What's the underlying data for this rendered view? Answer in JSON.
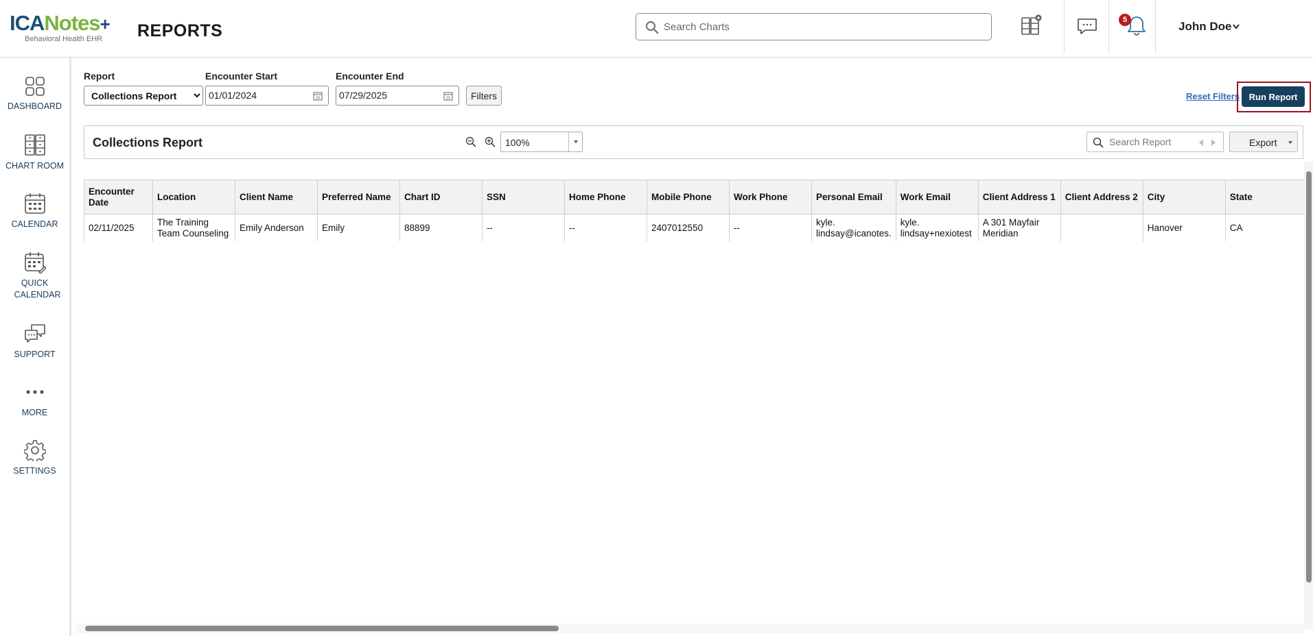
{
  "header": {
    "logo_text_1": "ICA",
    "logo_text_2": "Notes",
    "logo_plus": "+",
    "logo_subtitle": "Behavioral Health EHR",
    "page_title": "REPORTS",
    "search_placeholder": "Search Charts",
    "notification_count": "5",
    "user_name": "John Doe"
  },
  "sidebar": {
    "items": [
      {
        "label": "DASHBOARD"
      },
      {
        "label": "CHART ROOM"
      },
      {
        "label": "CALENDAR"
      },
      {
        "label": "QUICK CALENDAR"
      },
      {
        "label": "SUPPORT"
      },
      {
        "label": "MORE"
      },
      {
        "label": "SETTINGS"
      }
    ]
  },
  "filters": {
    "report_label": "Report",
    "report_value": "Collections Report",
    "encounter_start_label": "Encounter Start",
    "encounter_start_value": "01/01/2024",
    "encounter_end_label": "Encounter End",
    "encounter_end_value": "07/29/2025",
    "filters_button": "Filters",
    "reset_filters": "Reset Filters",
    "run_report": "Run Report"
  },
  "report_panel": {
    "title": "Collections Report",
    "zoom_value": "100%",
    "search_placeholder": "Search Report",
    "export_label": "Export"
  },
  "table": {
    "columns": [
      "Encounter Date",
      "Location",
      "Client Name",
      "Preferred Name",
      "Chart ID",
      "SSN",
      "Home Phone",
      "Mobile Phone",
      "Work Phone",
      "Personal Email",
      "Work Email",
      "Client Address 1",
      "Client Address 2",
      "City",
      "State"
    ],
    "rows": [
      [
        "02/11/2025",
        "The Training Team Counseling",
        "Emily Anderson",
        "Emily",
        "88899",
        "--",
        "--",
        "2407012550",
        "--",
        "kyle.\nlindsay@icanotes.",
        "kyle.\nlindsay+nexiotest",
        "A 301 Mayfair Meridian",
        "",
        "Hanover",
        "CA"
      ]
    ]
  },
  "colors": {
    "brand_blue": "#1e4e79",
    "brand_green": "#7cb342",
    "run_button": "#17405f",
    "highlight_border": "#9b111e",
    "badge": "#b71c1c",
    "link": "#2a6ebb"
  }
}
